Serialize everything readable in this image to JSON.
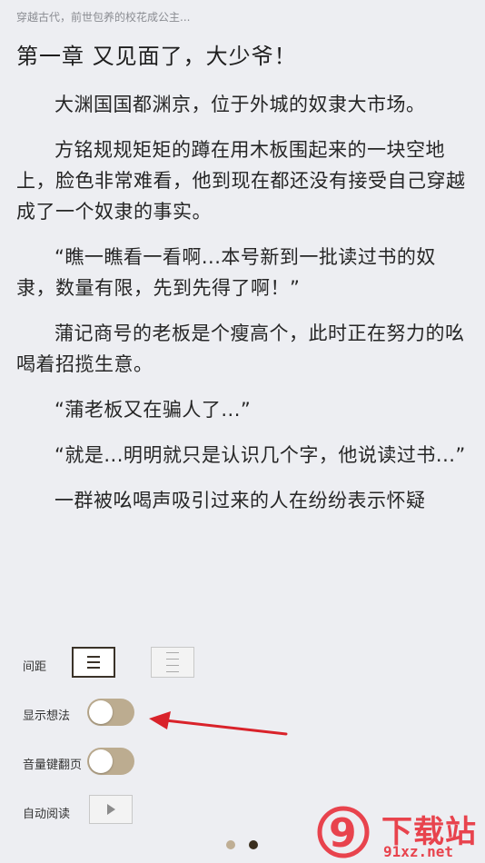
{
  "book": {
    "header": "穿越古代，前世包养的校花成公主...",
    "chapter_title": "第一章 又见面了，大少爷！"
  },
  "content": {
    "paragraphs": [
      "大渊国国都渊京，位于外城的奴隶大市场。",
      "方铭规规矩矩的蹲在用木板围起来的一块空地上，脸色非常难看，他到现在都还没有接受自己穿越成了一个奴隶的事实。",
      "“瞧一瞧看一看啊...本号新到一批读过书的奴隶，数量有限，先到先得了啊！”",
      "蒲记商号的老板是个瘦高个，此时正在努力的吆喝着招揽生意。",
      "“蒲老板又在骗人了...”",
      "“就是...明明就只是认识几个字，他说读过书...”",
      "一群被吆喝声吸引过来的人在纷纷表示怀疑"
    ]
  },
  "settings": {
    "spacing_label": "间距",
    "show_thoughts_label": "显示想法",
    "show_thoughts_on": false,
    "volume_page_label": "音量键翻页",
    "volume_page_on": false,
    "auto_read_label": "自动阅读"
  },
  "pager": {
    "current": 2,
    "total": 2
  },
  "watermark": {
    "brand": "下载站",
    "url": "91xz.net",
    "logo_glyph": "9"
  },
  "colors": {
    "background": "#edeef2",
    "toggle_track": "#bcac90",
    "arrow": "#d9222a",
    "dot_active": "#3a2e1e",
    "dot_inactive": "#bfae94",
    "watermark": "#e8434d"
  }
}
